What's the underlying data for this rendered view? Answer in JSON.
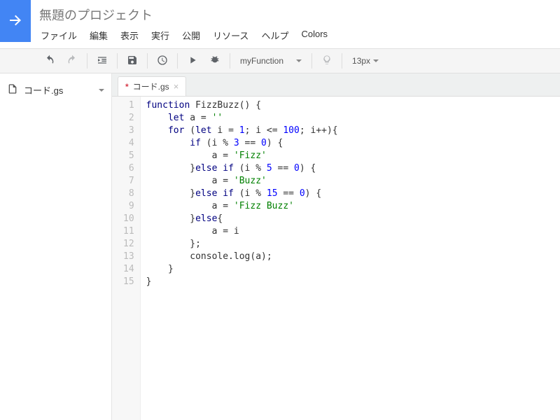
{
  "header": {
    "project_title": "無題のプロジェクト",
    "menus": [
      "ファイル",
      "編集",
      "表示",
      "実行",
      "公開",
      "リソース",
      "ヘルプ",
      "Colors"
    ]
  },
  "toolbar": {
    "function_selected": "myFunction",
    "font_size_label": "13px"
  },
  "sidebar": {
    "files": [
      {
        "name": "コード.gs"
      }
    ]
  },
  "tabs": [
    {
      "name": "コード.gs",
      "dirty_marker": "*"
    }
  ],
  "editor": {
    "line_count": 15,
    "code_lines": [
      [
        {
          "t": "kw",
          "v": "function"
        },
        {
          "t": "",
          "v": " "
        },
        {
          "t": "fn",
          "v": "FizzBuzz"
        },
        {
          "t": "",
          "v": "() {"
        }
      ],
      [
        {
          "t": "",
          "v": "    "
        },
        {
          "t": "kw",
          "v": "let"
        },
        {
          "t": "",
          "v": " a = "
        },
        {
          "t": "str",
          "v": "''"
        }
      ],
      [
        {
          "t": "",
          "v": "    "
        },
        {
          "t": "kw",
          "v": "for"
        },
        {
          "t": "",
          "v": " ("
        },
        {
          "t": "kw",
          "v": "let"
        },
        {
          "t": "",
          "v": " i = "
        },
        {
          "t": "num",
          "v": "1"
        },
        {
          "t": "",
          "v": "; i <= "
        },
        {
          "t": "num",
          "v": "100"
        },
        {
          "t": "",
          "v": "; i++){"
        }
      ],
      [
        {
          "t": "",
          "v": "        "
        },
        {
          "t": "kw",
          "v": "if"
        },
        {
          "t": "",
          "v": " (i % "
        },
        {
          "t": "num",
          "v": "3"
        },
        {
          "t": "",
          "v": " == "
        },
        {
          "t": "num",
          "v": "0"
        },
        {
          "t": "",
          "v": ") {"
        }
      ],
      [
        {
          "t": "",
          "v": "            a = "
        },
        {
          "t": "str",
          "v": "'Fizz'"
        }
      ],
      [
        {
          "t": "",
          "v": "        }"
        },
        {
          "t": "kw",
          "v": "else if"
        },
        {
          "t": "",
          "v": " (i % "
        },
        {
          "t": "num",
          "v": "5"
        },
        {
          "t": "",
          "v": " == "
        },
        {
          "t": "num",
          "v": "0"
        },
        {
          "t": "",
          "v": ") {"
        }
      ],
      [
        {
          "t": "",
          "v": "            a = "
        },
        {
          "t": "str",
          "v": "'Buzz'"
        }
      ],
      [
        {
          "t": "",
          "v": "        }"
        },
        {
          "t": "kw",
          "v": "else if"
        },
        {
          "t": "",
          "v": " (i % "
        },
        {
          "t": "num",
          "v": "15"
        },
        {
          "t": "",
          "v": " == "
        },
        {
          "t": "num",
          "v": "0"
        },
        {
          "t": "",
          "v": ") {"
        }
      ],
      [
        {
          "t": "",
          "v": "            a = "
        },
        {
          "t": "str",
          "v": "'Fizz Buzz'"
        }
      ],
      [
        {
          "t": "",
          "v": "        }"
        },
        {
          "t": "kw",
          "v": "else"
        },
        {
          "t": "",
          "v": "{"
        }
      ],
      [
        {
          "t": "",
          "v": "            a = i"
        }
      ],
      [
        {
          "t": "",
          "v": "        };"
        }
      ],
      [
        {
          "t": "",
          "v": "        console.log(a);"
        }
      ],
      [
        {
          "t": "",
          "v": "    }"
        }
      ],
      [
        {
          "t": "",
          "v": "}"
        }
      ]
    ]
  },
  "icons": {
    "arrow": "arrow-right-icon",
    "undo": "undo-icon",
    "redo": "redo-icon",
    "indent": "indent-icon",
    "save": "save-icon",
    "clock": "clock-icon",
    "run": "play-icon",
    "debug": "bug-icon",
    "lightbulb": "lightbulb-icon",
    "file": "file-icon"
  }
}
